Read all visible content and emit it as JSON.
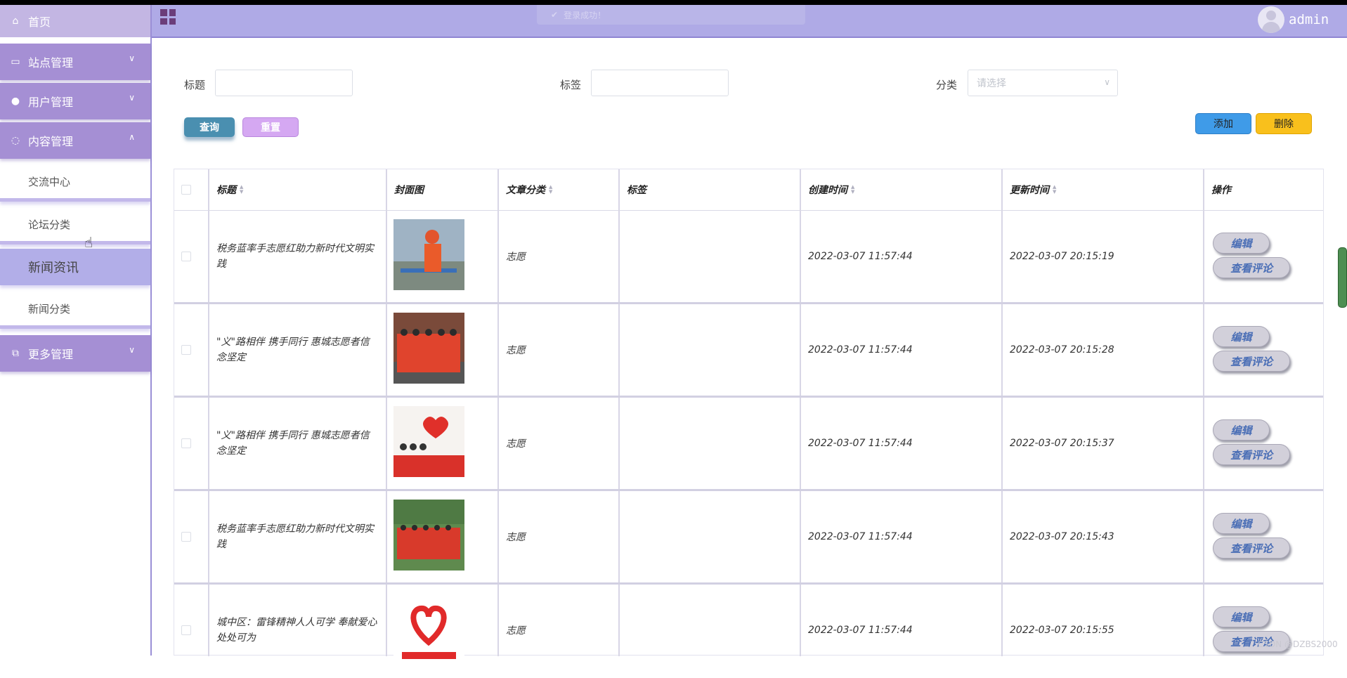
{
  "sidebar": {
    "home_label": "首页",
    "groups": [
      {
        "label": "站点管理",
        "icon": "monitor-icon"
      },
      {
        "label": "用户管理",
        "icon": "user-icon"
      },
      {
        "label": "内容管理",
        "icon": "chat-icon"
      },
      {
        "label": "更多管理",
        "icon": "copy-icon"
      }
    ],
    "content_items": [
      "交流中心",
      "论坛分类",
      "新闻资讯",
      "新闻分类"
    ],
    "active_item": "新闻资讯"
  },
  "header": {
    "toast_text": "登录成功！",
    "username": "admin"
  },
  "filters": {
    "title_label": "标题",
    "tag_label": "标签",
    "category_label": "分类",
    "category_placeholder": "请选择"
  },
  "actions": {
    "query": "查询",
    "reset": "重置",
    "add": "添加",
    "delete": "删除"
  },
  "table": {
    "headers": [
      "标题",
      "封面图",
      "文章分类",
      "标签",
      "创建时间",
      "更新时间",
      "操作"
    ],
    "rows": [
      {
        "title": "税务蓝率手志愿红助力新时代文明实践",
        "category": "志愿",
        "tag": "",
        "created": "2022-03-07 11:57:44",
        "updated": "2022-03-07 20:15:19"
      },
      {
        "title": "\"义\"路相伴 携手同行 惠城志愿者信念坚定",
        "category": "志愿",
        "tag": "",
        "created": "2022-03-07 11:57:44",
        "updated": "2022-03-07 20:15:28"
      },
      {
        "title": "\"义\"路相伴 携手同行 惠城志愿者信念坚定",
        "category": "志愿",
        "tag": "",
        "created": "2022-03-07 11:57:44",
        "updated": "2022-03-07 20:15:37"
      },
      {
        "title": "税务蓝率手志愿红助力新时代文明实践",
        "category": "志愿",
        "tag": "",
        "created": "2022-03-07 11:57:44",
        "updated": "2022-03-07 20:15:43"
      },
      {
        "title": "城中区：雷锋精神人人可学 奉献爱心处处可为",
        "category": "志愿",
        "tag": "",
        "created": "2022-03-07 11:57:44",
        "updated": "2022-03-07 20:15:55"
      }
    ],
    "edit_label": "编辑",
    "view_comments_label": "查看评论"
  },
  "watermark": "CSDN @DZBS2000"
}
